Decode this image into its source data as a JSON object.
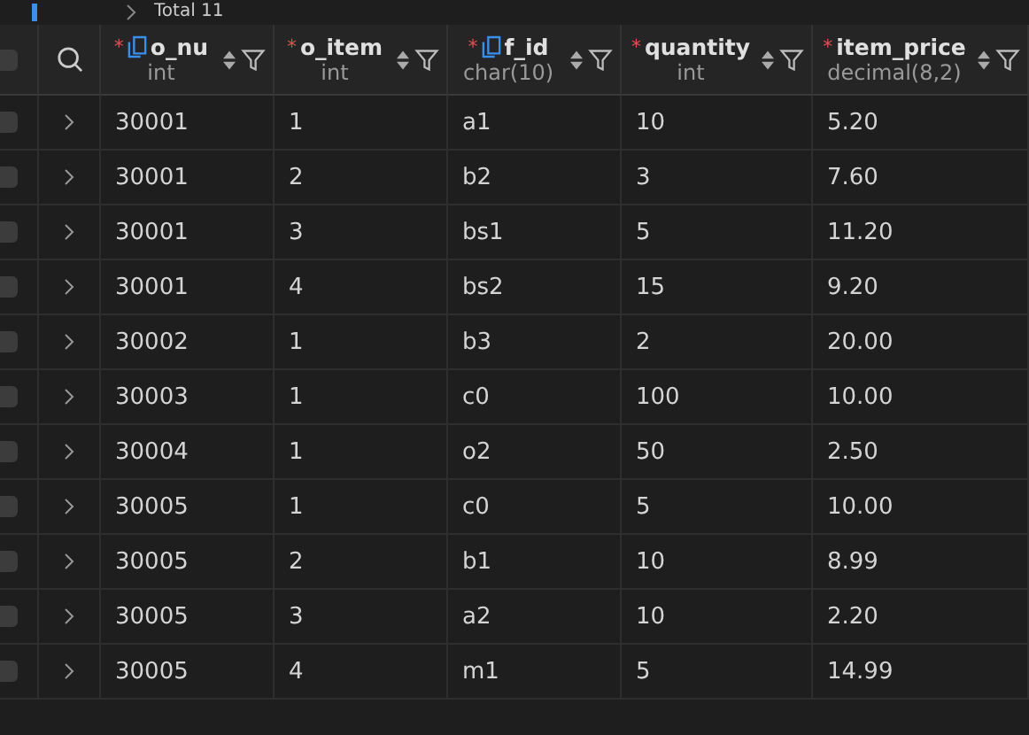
{
  "top_bar": {
    "label": "Total 11"
  },
  "select_all": {
    "checked": false
  },
  "columns": [
    {
      "name": "o_nu",
      "type": "int",
      "key": true,
      "required_mark": "*"
    },
    {
      "name": "o_item",
      "type": "int",
      "key": false,
      "required_mark": "*"
    },
    {
      "name": "f_id",
      "type": "char(10)",
      "key": true,
      "required_mark": "*"
    },
    {
      "name": "quantity",
      "type": "int",
      "key": false,
      "required_mark": "*"
    },
    {
      "name": "item_price",
      "type": "decimal(8,2)",
      "key": false,
      "required_mark": "*"
    }
  ],
  "rows": [
    {
      "checked": false,
      "cells": [
        "30001",
        "1",
        "a1",
        "10",
        "5.20"
      ]
    },
    {
      "checked": false,
      "cells": [
        "30001",
        "2",
        "b2",
        "3",
        "7.60"
      ]
    },
    {
      "checked": false,
      "cells": [
        "30001",
        "3",
        "bs1",
        "5",
        "11.20"
      ]
    },
    {
      "checked": false,
      "cells": [
        "30001",
        "4",
        "bs2",
        "15",
        "9.20"
      ]
    },
    {
      "checked": false,
      "cells": [
        "30002",
        "1",
        "b3",
        "2",
        "20.00"
      ]
    },
    {
      "checked": false,
      "cells": [
        "30003",
        "1",
        "c0",
        "100",
        "10.00"
      ]
    },
    {
      "checked": false,
      "cells": [
        "30004",
        "1",
        "o2",
        "50",
        "2.50"
      ]
    },
    {
      "checked": false,
      "cells": [
        "30005",
        "1",
        "c0",
        "5",
        "10.00"
      ]
    },
    {
      "checked": false,
      "cells": [
        "30005",
        "2",
        "b1",
        "10",
        "8.99"
      ]
    },
    {
      "checked": false,
      "cells": [
        "30005",
        "3",
        "a2",
        "10",
        "2.20"
      ]
    },
    {
      "checked": false,
      "cells": [
        "30005",
        "4",
        "m1",
        "5",
        "14.99"
      ]
    }
  ]
}
